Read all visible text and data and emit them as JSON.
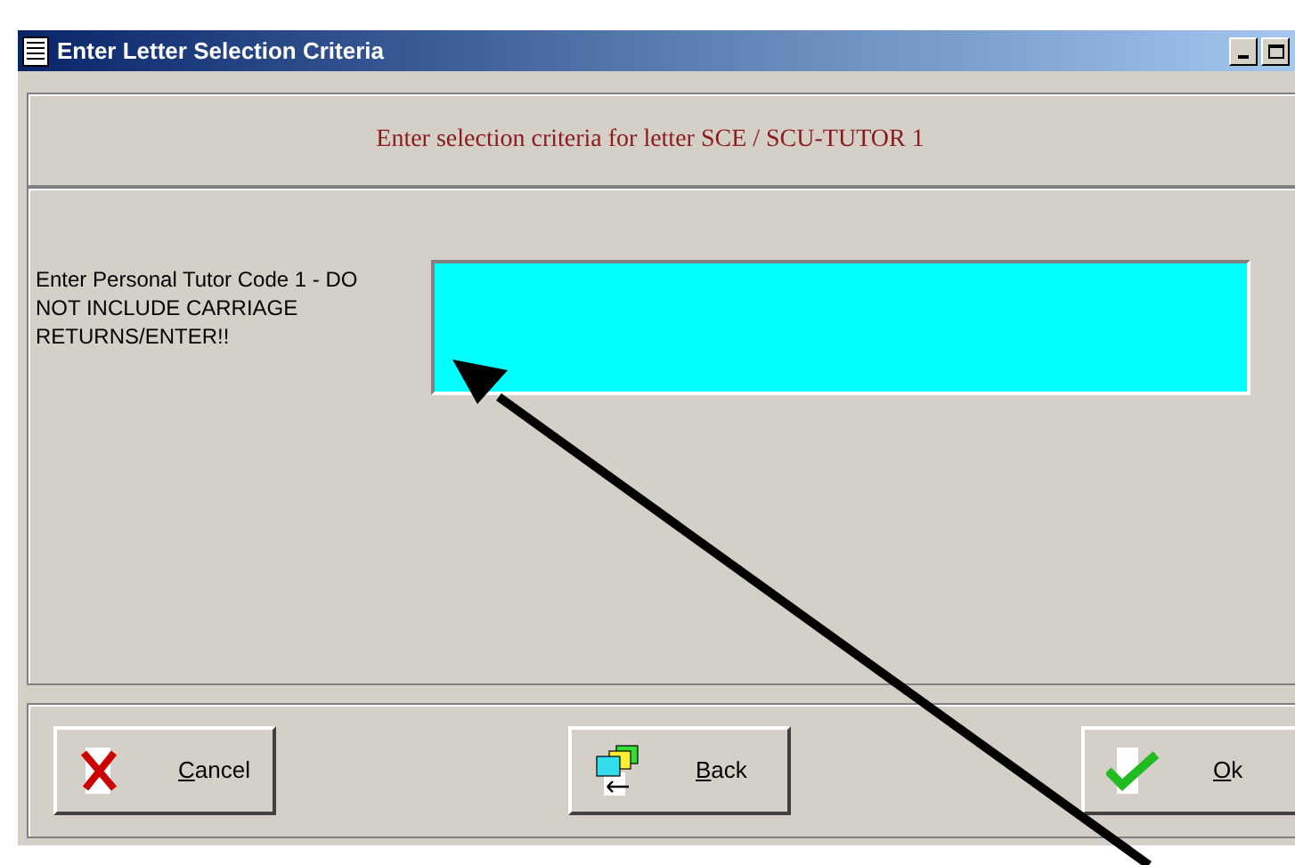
{
  "window": {
    "title": "Enter Letter Selection Criteria"
  },
  "header": {
    "text": "Enter selection criteria for letter SCE / SCU-TUTOR 1"
  },
  "field": {
    "label": "Enter Personal Tutor Code 1 - DO NOT INCLUDE CARRIAGE RETURNS/ENTER!!"
  },
  "buttons": [
    {
      "kind": "cancel",
      "label": "Cancel"
    },
    {
      "kind": "back",
      "label": "Back"
    },
    {
      "kind": "ok",
      "label": "Ok"
    }
  ]
}
